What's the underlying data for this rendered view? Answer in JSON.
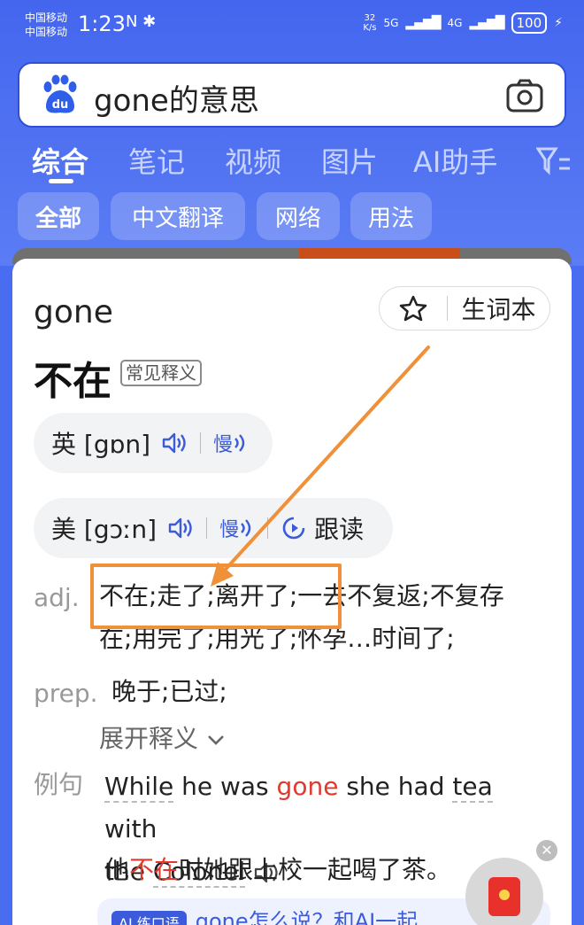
{
  "status_bar": {
    "carrier1": "中国移动",
    "carrier2": "中国移动",
    "time": "1:23",
    "icons": "N ✱",
    "speed_top": "32",
    "speed_bottom": "K/s",
    "net1": "5G",
    "net2": "4G",
    "battery": "100"
  },
  "search": {
    "query": "gone的意思",
    "logo_icon": "baidu-paw-icon",
    "camera_icon": "camera-icon"
  },
  "tabs": [
    "综合",
    "笔记",
    "视频",
    "图片",
    "AI助手"
  ],
  "filter_icon": "filter-icon",
  "chips": [
    "全部",
    "中文翻译",
    "网络",
    "用法"
  ],
  "entry": {
    "word": "gone",
    "vocab_label": "生词本",
    "main_meaning": "不在",
    "badge": "常见释义",
    "uk": {
      "label": "英 [gɒn]",
      "slow": "慢"
    },
    "us": {
      "label": "美 [gɔːn]",
      "slow": "慢",
      "follow": "跟读"
    },
    "adj": {
      "pos": "adj.",
      "line1": "不在;走了;离开了;一去不复返;不复存",
      "line2": "在;用完了;用光了;怀孕…时间了;"
    },
    "prep": {
      "pos": "prep.",
      "text": "晚于;已过;"
    },
    "expand": "展开释义",
    "example": {
      "label": "例句",
      "en_1": "While",
      "en_2": " he was ",
      "en_red": "gone",
      "en_3": " she had ",
      "en_tea": "tea",
      "en_4": " with",
      "en_5": "the ",
      "en_colonel": "Colonel",
      "zh_1": "他",
      "zh_red": "不在",
      "zh_2": "时她跟上校一起喝了茶。"
    },
    "ai_tag": "AI 练口语",
    "ai_text": "gone怎么说？和AI一起"
  },
  "colors": {
    "brand_blue": "#4a6cf0",
    "highlight_orange": "#f0913a",
    "red_text": "#e03a2e"
  }
}
